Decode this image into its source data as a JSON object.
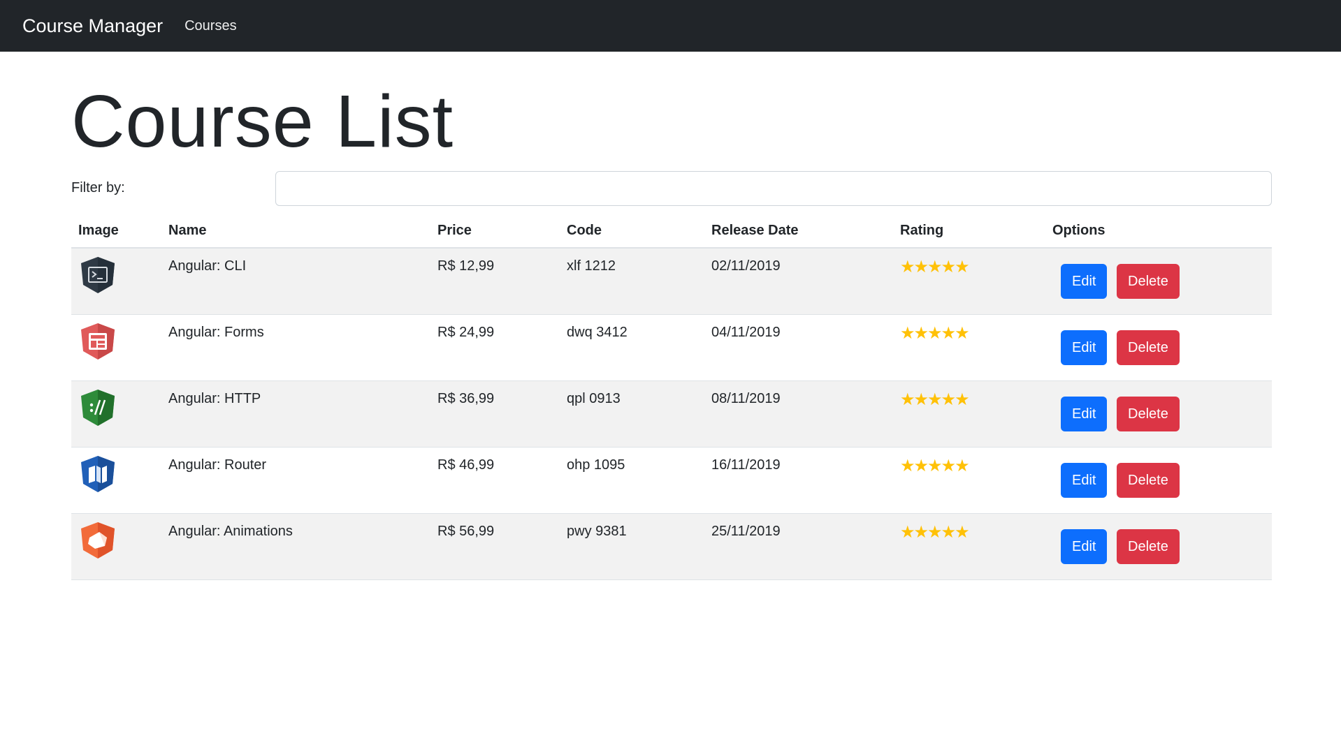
{
  "navbar": {
    "brand": "Course Manager",
    "links": [
      "Courses"
    ]
  },
  "page": {
    "title": "Course List",
    "filter_label": "Filter by:",
    "filter_value": ""
  },
  "table": {
    "headers": [
      "Image",
      "Name",
      "Price",
      "Code",
      "Release Date",
      "Rating",
      "Options"
    ],
    "rows": [
      {
        "icon": "cli-icon",
        "name": "Angular: CLI",
        "price": "R$ 12,99",
        "code": "xlf 1212",
        "release": "02/11/2019",
        "rating": 5,
        "stars": "★★★★★"
      },
      {
        "icon": "forms-icon",
        "name": "Angular: Forms",
        "price": "R$ 24,99",
        "code": "dwq 3412",
        "release": "04/11/2019",
        "rating": 5,
        "stars": "★★★★★"
      },
      {
        "icon": "http-icon",
        "name": "Angular: HTTP",
        "price": "R$ 36,99",
        "code": "qpl 0913",
        "release": "08/11/2019",
        "rating": 5,
        "stars": "★★★★★"
      },
      {
        "icon": "router-icon",
        "name": "Angular: Router",
        "price": "R$ 46,99",
        "code": "ohp 1095",
        "release": "16/11/2019",
        "rating": 5,
        "stars": "★★★★★"
      },
      {
        "icon": "animations-icon",
        "name": "Angular: Animations",
        "price": "R$ 56,99",
        "code": "pwy 9381",
        "release": "25/11/2019",
        "rating": 5,
        "stars": "★★★★★"
      }
    ],
    "edit_label": "Edit",
    "delete_label": "Delete"
  },
  "colors": {
    "navbar": "#212529",
    "edit_button": "#0d6efd",
    "delete_button": "#dc3545",
    "star": "#ffc107",
    "striped_row": "#f2f2f2"
  }
}
